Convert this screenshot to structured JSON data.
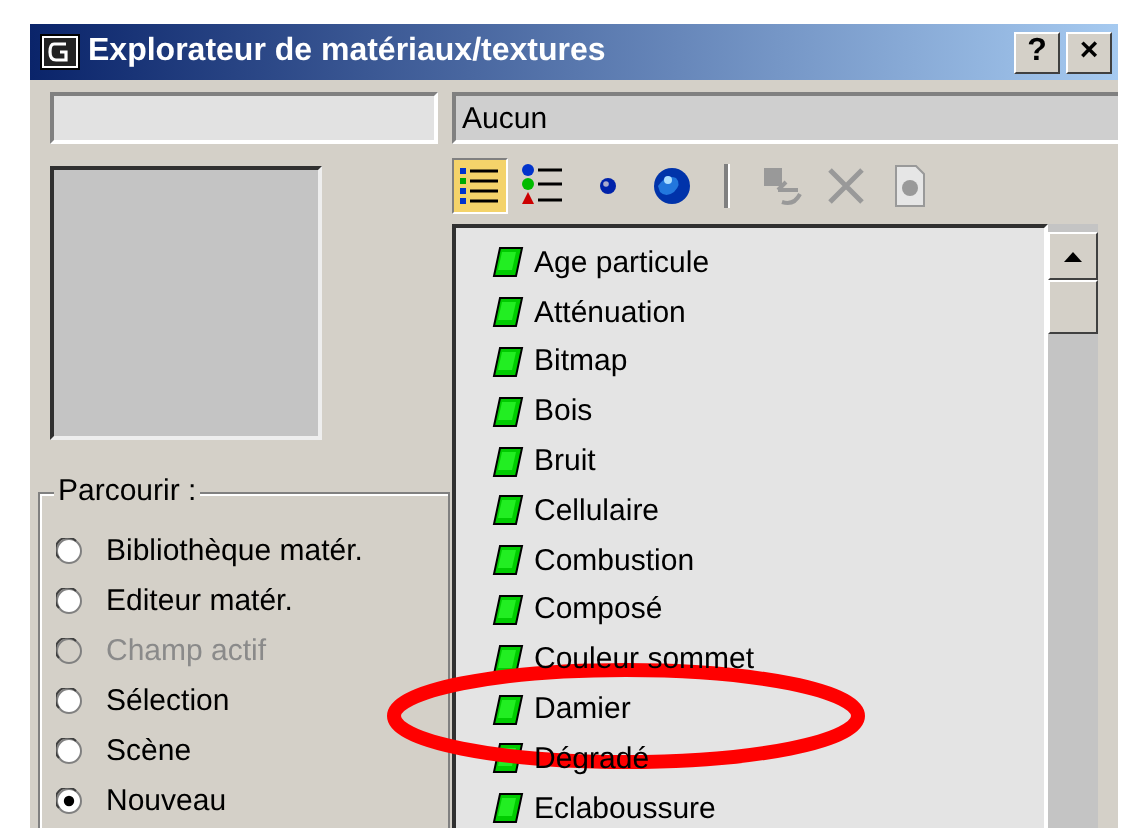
{
  "window": {
    "title": "Explorateur de matériaux/textures",
    "buttons": [
      {
        "label": "?"
      },
      {
        "label": "×"
      }
    ]
  },
  "current_name": {
    "value": "Aucun"
  },
  "view_buttons": [
    {
      "kind": "list",
      "selected": true
    },
    {
      "kind": "list-icons",
      "selected": false
    },
    {
      "kind": "small-icons",
      "selected": false
    },
    {
      "kind": "large-icons",
      "selected": false
    }
  ],
  "action_buttons": [
    {
      "kind": "get",
      "disabled": true
    },
    {
      "kind": "delete",
      "disabled": true
    },
    {
      "kind": "clear",
      "disabled": true
    }
  ],
  "browse": {
    "title": "Parcourir :",
    "options": [
      {
        "label": "Bibliothèque matér.",
        "selected": false,
        "disabled": false
      },
      {
        "label": "Editeur matér.",
        "selected": false,
        "disabled": false
      },
      {
        "label": "Champ actif",
        "selected": false,
        "disabled": true
      },
      {
        "label": "Sélection",
        "selected": false,
        "disabled": false
      },
      {
        "label": "Scène",
        "selected": false,
        "disabled": false
      },
      {
        "label": "Nouveau",
        "selected": true,
        "disabled": false
      }
    ]
  },
  "maps": [
    {
      "label": "Age particule"
    },
    {
      "label": "Atténuation"
    },
    {
      "label": "Bitmap"
    },
    {
      "label": "Bois"
    },
    {
      "label": "Bruit"
    },
    {
      "label": "Cellulaire"
    },
    {
      "label": "Combustion"
    },
    {
      "label": "Composé"
    },
    {
      "label": "Couleur sommet"
    },
    {
      "label": "Damier"
    },
    {
      "label": "Dégradé"
    },
    {
      "label": "Eclaboussure"
    }
  ],
  "annotations": [
    {
      "kind": "ellipse",
      "color": "#ff0000"
    }
  ]
}
